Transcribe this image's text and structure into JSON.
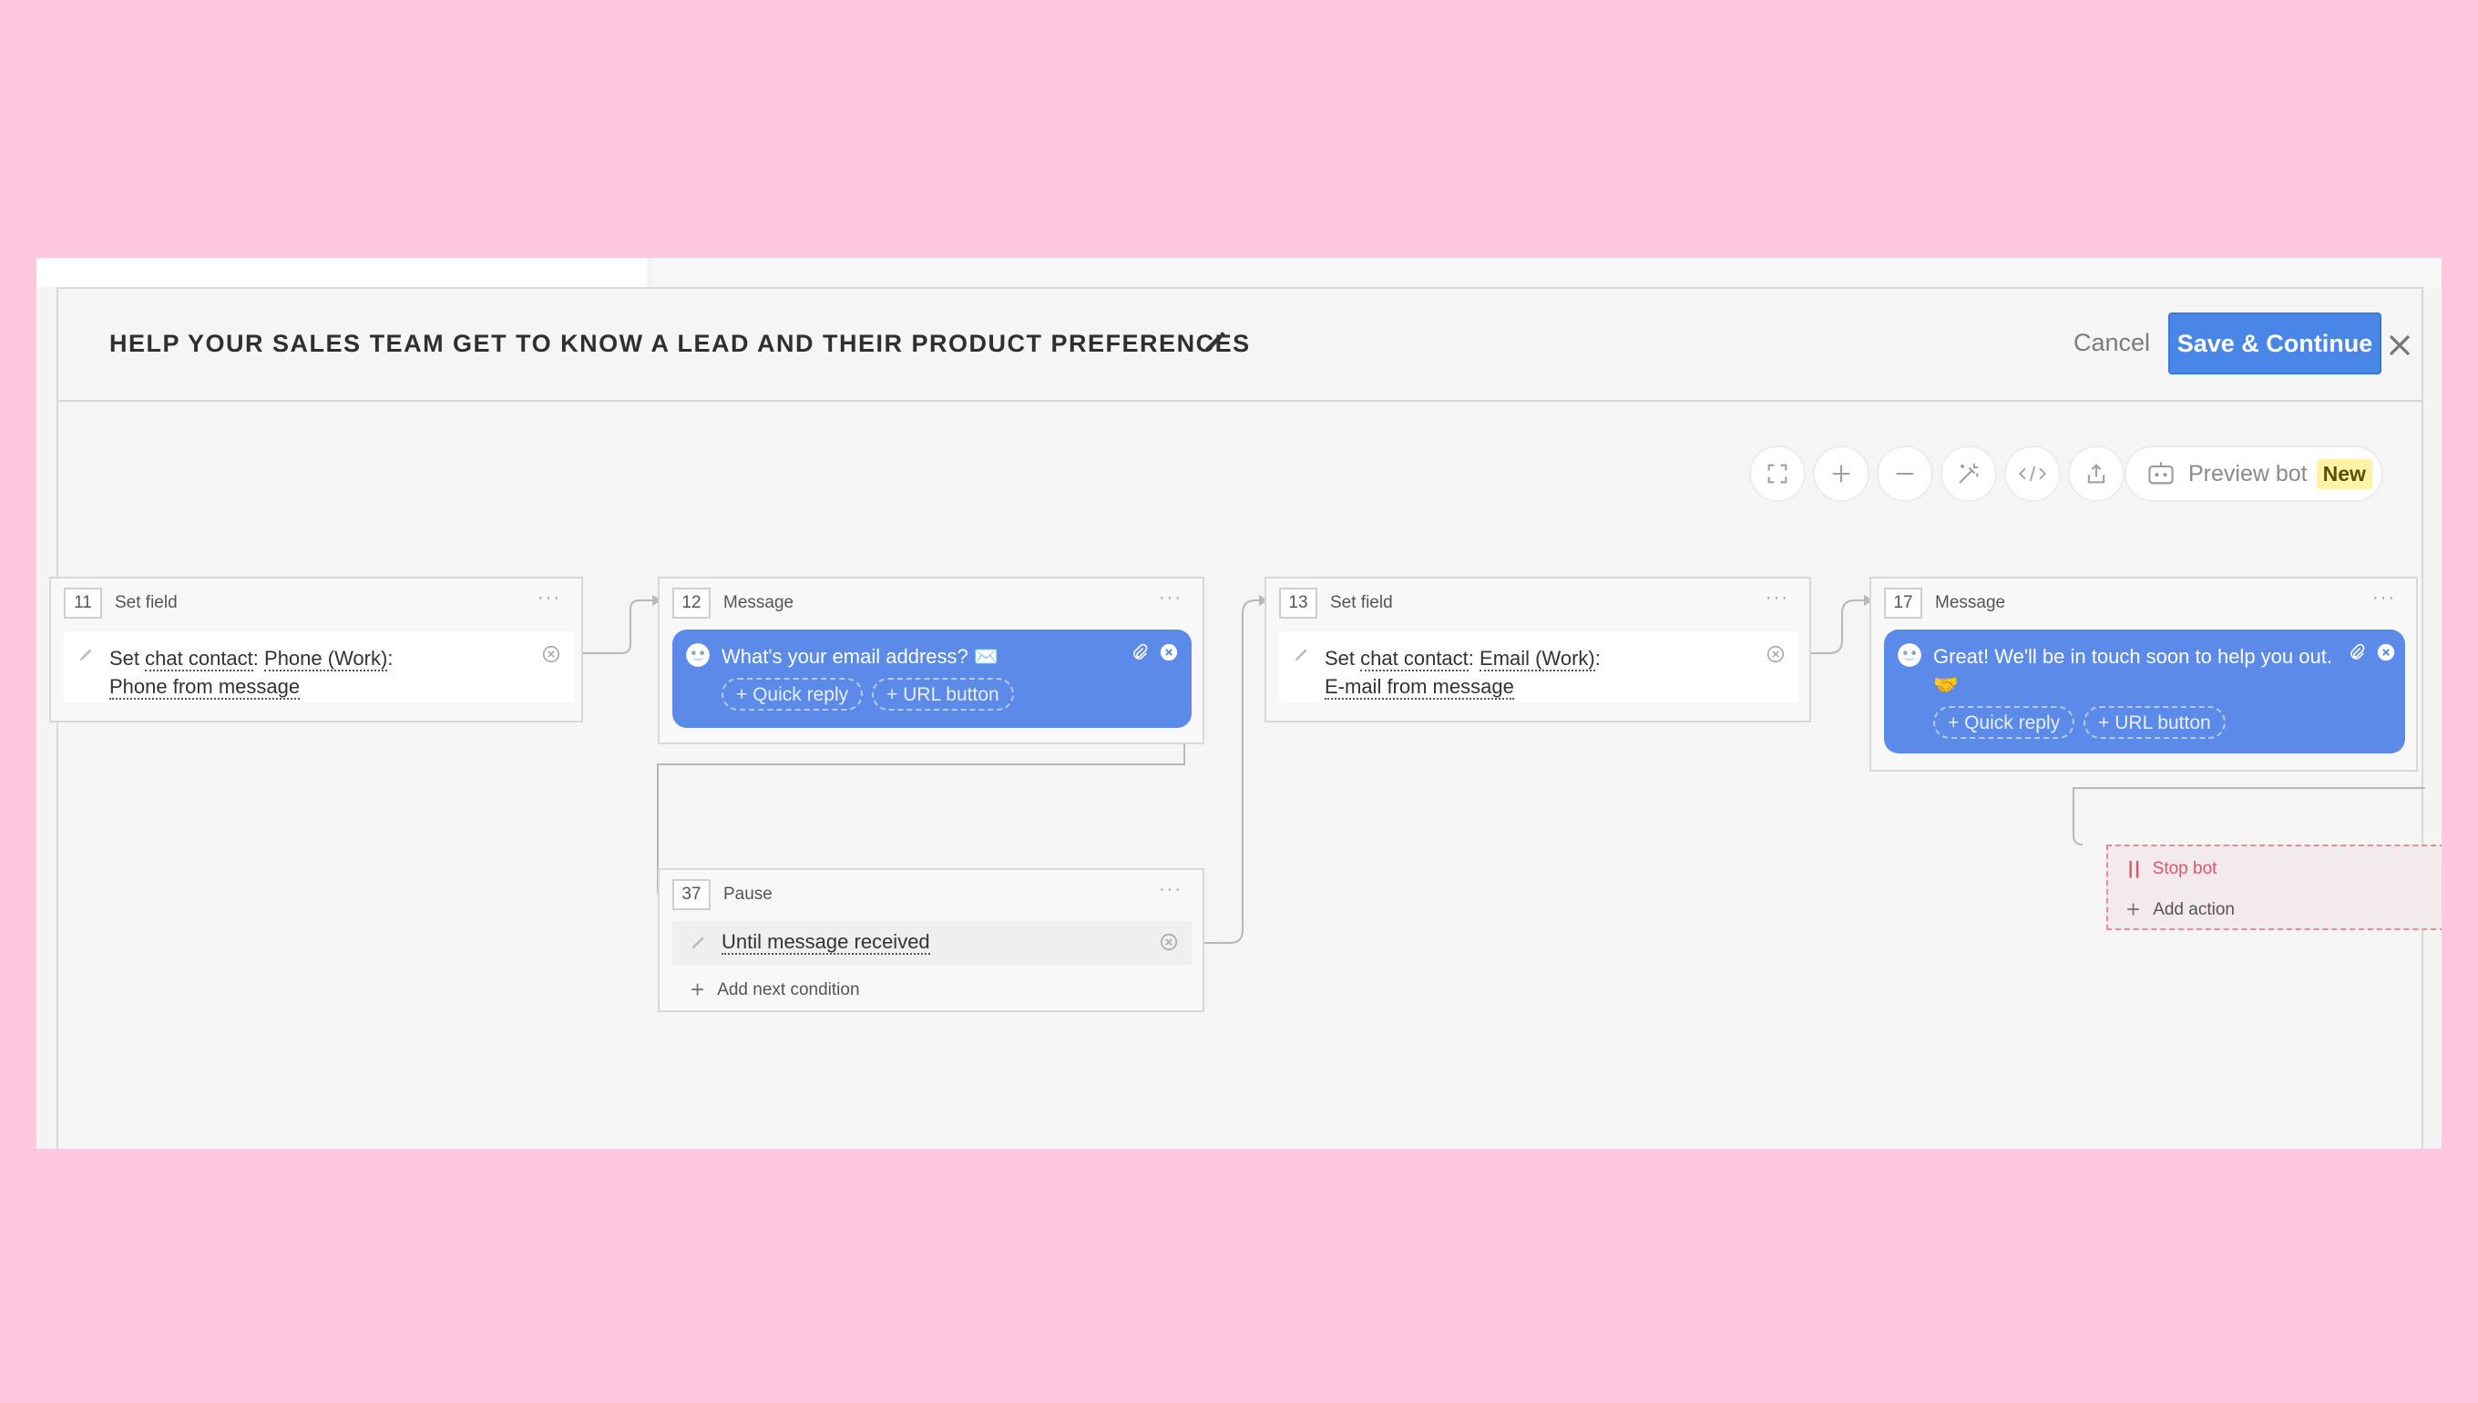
{
  "header": {
    "title": "HELP YOUR SALES TEAM GET TO KNOW A LEAD AND THEIR PRODUCT PREFERENCES",
    "cancel_label": "Cancel",
    "save_label": "Save & Continue"
  },
  "toolbar": {
    "preview_label": "Preview bot",
    "new_badge": "New",
    "icons": [
      "fullscreen-icon",
      "zoom-in-icon",
      "zoom-out-icon",
      "magic-wand-icon",
      "code-icon",
      "export-icon"
    ]
  },
  "nodes": {
    "n11": {
      "number": "11",
      "type": "Set field",
      "prefix": "Set ",
      "target": "chat contact",
      "sep": ": ",
      "field": "Phone (Work)",
      "colon": ":",
      "value": "Phone from message"
    },
    "n12": {
      "number": "12",
      "type": "Message",
      "text": "What's your email address? ✉️",
      "quick_reply": "+ Quick reply",
      "url_button": "+ URL button"
    },
    "n13": {
      "number": "13",
      "type": "Set field",
      "prefix": "Set ",
      "target": "chat contact",
      "sep": ": ",
      "field": "Email (Work)",
      "colon": ":",
      "value": "E-mail from message"
    },
    "n17": {
      "number": "17",
      "type": "Message",
      "text": "Great! We'll be in touch soon to help you out. 🤝",
      "quick_reply": "+ Quick reply",
      "url_button": "+ URL button"
    },
    "n37": {
      "number": "37",
      "type": "Pause",
      "condition": "Until message received",
      "add_condition": "Add next condition"
    }
  },
  "stop": {
    "stop_label": "Stop bot",
    "add_action": "Add action"
  },
  "more_glyph": "···",
  "colors": {
    "primary": "#4a86e8",
    "bubble": "#5b8ae8",
    "stop": "#e0546b",
    "badge": "#fff3a8"
  }
}
